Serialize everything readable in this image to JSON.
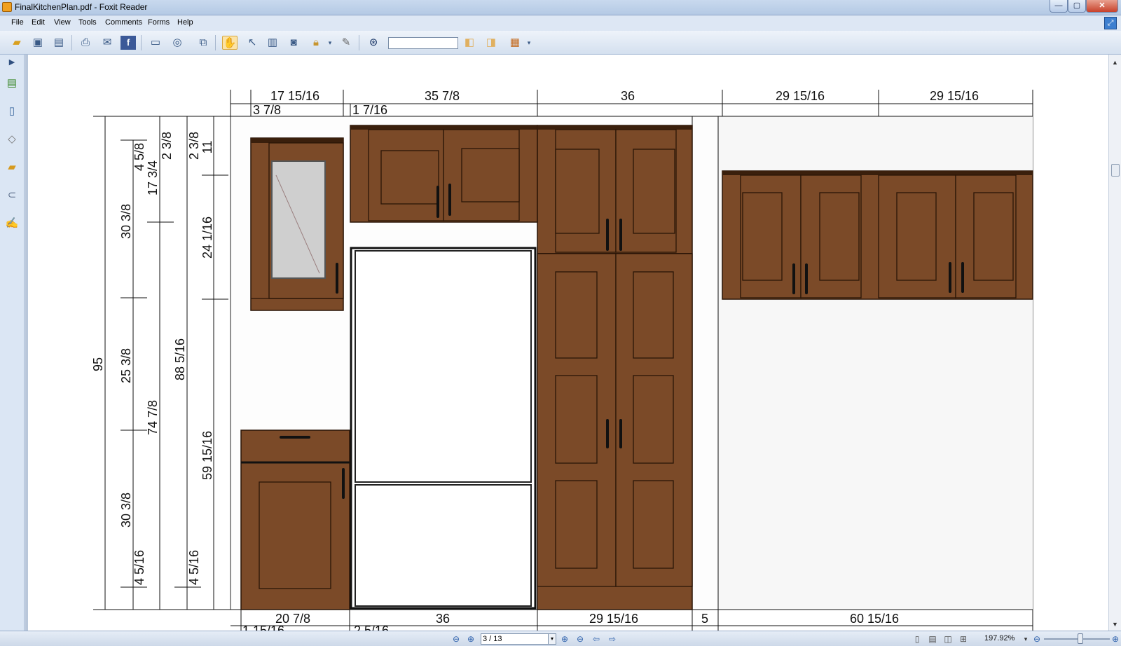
{
  "window": {
    "title": "FinalKitchenPlan.pdf - Foxit Reader",
    "minimize_glyph": "—",
    "maximize_glyph": "▢",
    "close_glyph": "✕"
  },
  "menu": {
    "items": [
      "File",
      "Edit",
      "View",
      "Tools",
      "Comments",
      "Forms",
      "Help"
    ]
  },
  "toolbar": {
    "find_value": "",
    "icons": [
      "open-icon",
      "save-icon",
      "save-as-icon",
      "print-icon",
      "email-icon",
      "facebook-icon",
      "fullscreen-icon",
      "fit-icon",
      "fit-page-icon",
      "hand-tool-icon",
      "select-tool-icon",
      "text-select-icon",
      "snapshot-icon",
      "rms-icon",
      "sign-icon",
      "find-icon",
      "find-prev-icon",
      "find-next-icon",
      "tools-menu-icon"
    ]
  },
  "left_panel": {
    "icons": [
      "collapse-arrow-icon",
      "bookmarks-icon",
      "pages-icon",
      "layers-icon",
      "comments-icon",
      "attachments-icon",
      "signatures-icon"
    ]
  },
  "drawing": {
    "top_dimensions_row1": [
      "17 15/16",
      "35 7/8",
      "36",
      "29 15/16",
      "29 15/16"
    ],
    "top_dimensions_row2": [
      "3 7/8",
      "1 7/16"
    ],
    "bottom_dimensions_row1": [
      "20 7/8",
      "36",
      "29 15/16",
      "5",
      "60 15/16"
    ],
    "bottom_dimensions_row2": [
      "1 15/16",
      "2 5/16"
    ],
    "left_dim_col1": [
      "95"
    ],
    "left_dim_col2": [
      "4 5/8",
      "30 3/8",
      "25 3/8",
      "30 3/8",
      "4 5/16"
    ],
    "left_dim_col3": [
      "2 3/8",
      "17 3/4",
      "74 7/8"
    ],
    "left_dim_col4": [
      "2 3/8",
      "88 5/16",
      "4 5/16"
    ],
    "left_dim_col5": [
      "11",
      "24 1/16",
      "59 15/16"
    ]
  },
  "status": {
    "page_value": "3 / 13",
    "zoom": "197.92%",
    "zoom_level_fraction": 0.55
  },
  "colors": {
    "cabinet_wood": "#7b4a28",
    "cabinet_edge": "#2a1507",
    "title_bar": "#c9d9ee"
  }
}
